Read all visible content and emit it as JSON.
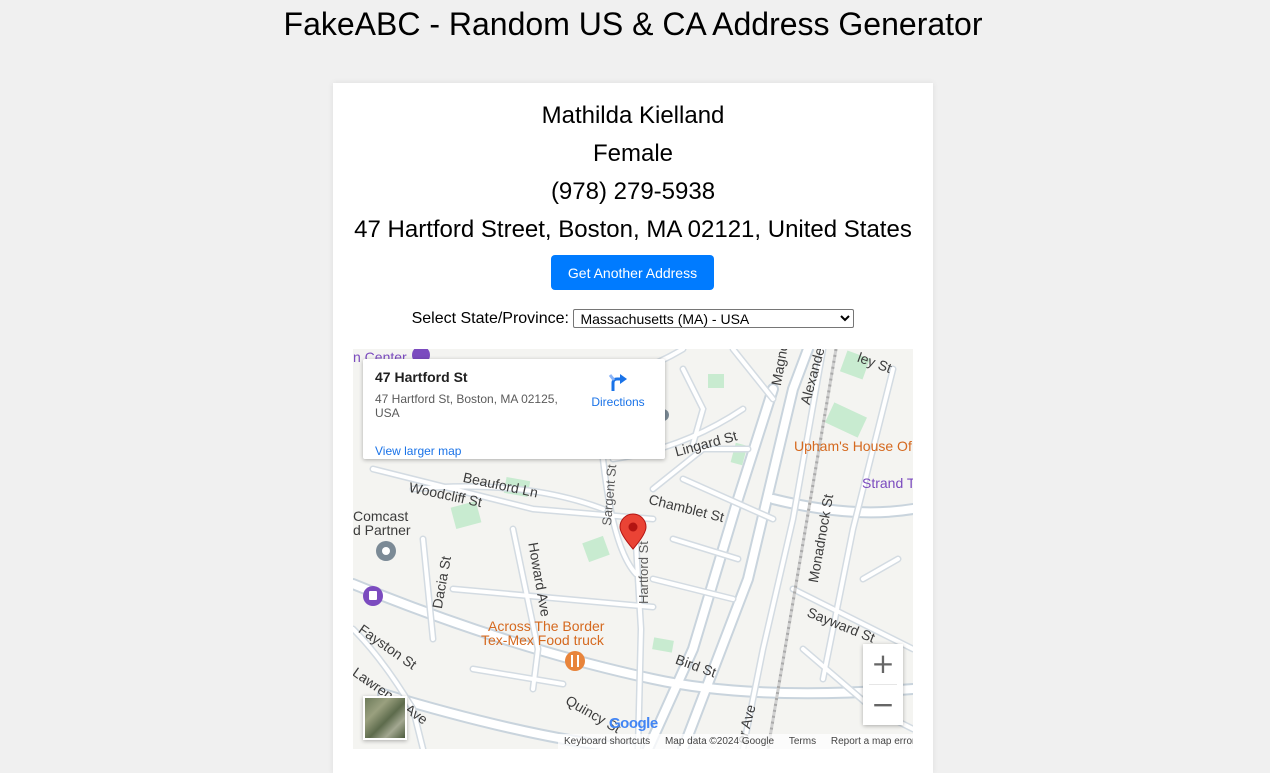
{
  "page": {
    "title": "FakeABC - Random US & CA Address Generator"
  },
  "person": {
    "name": "Mathilda Kielland",
    "gender": "Female",
    "phone": "(978) 279-5938",
    "address": "47 Hartford Street, Boston, MA 02121, United States"
  },
  "actions": {
    "another_address_label": "Get Another Address"
  },
  "state_select": {
    "label": "Select State/Province:",
    "selected": "Massachusetts (MA) - USA"
  },
  "map": {
    "infowindow": {
      "title": "47 Hartford St",
      "address": "47 Hartford St, Boston, MA 02125, USA",
      "directions_label": "Directions",
      "larger_map_label": "View larger map"
    },
    "streets": {
      "hartford": "Hartford St",
      "sargent": "Sargent St",
      "chamblet": "Chamblet St",
      "lingard": "Lingard St",
      "beauford": "Beauford Ln",
      "woodcliff": "Woodcliff St",
      "howard": "Howard Ave",
      "dacia": "Dacia St",
      "fayston": "Fayston St",
      "lawrence": "Lawrence Ave",
      "quincy": "Quincy St",
      "bird": "Bird St",
      "sayward": "Sayward St",
      "monadnock": "Monadnock St",
      "magnolia": "Magno",
      "alexander": "Alexande",
      "ley": "ley St",
      "ave_partial": "er Ave"
    },
    "pois": {
      "uphams": "Upham's House Of",
      "strand": "Strand T",
      "comcast_1": "Comcast",
      "comcast_2": "d Partner",
      "across_1": "Across The Border",
      "across_2": "Tex-Mex Food truck",
      "center": "n Center"
    },
    "zoom_in": "+",
    "zoom_out": "−",
    "google_logo": "Google",
    "attribution": {
      "shortcuts": "Keyboard shortcuts",
      "data": "Map data ©2024 Google",
      "terms": "Terms",
      "report": "Report a map error"
    },
    "colors": {
      "road": "#ffffff",
      "road_edge": "#c9d4dd",
      "park": "#c8ebd0",
      "marker": "#ea4335"
    }
  }
}
